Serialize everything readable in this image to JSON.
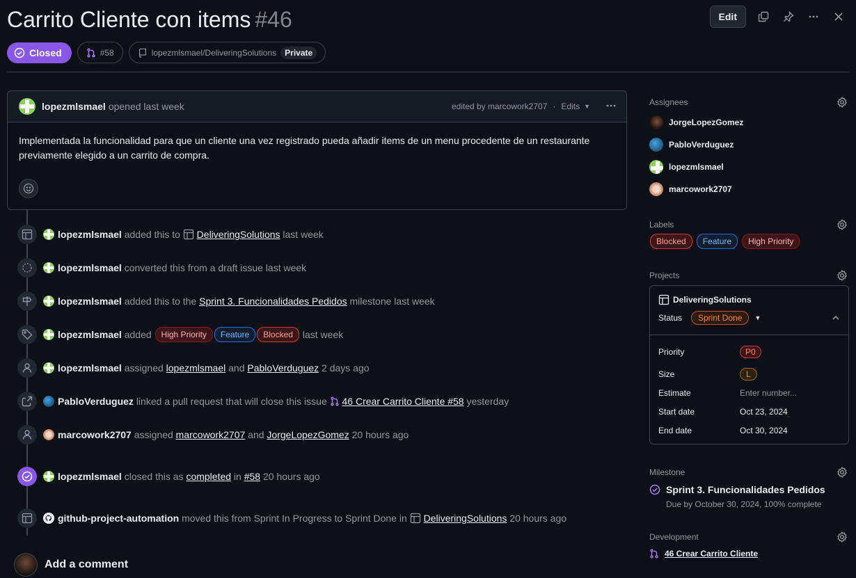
{
  "issue": {
    "title": "Carrito Cliente con items",
    "number": "#46",
    "state": "Closed",
    "pr_ref": "#58",
    "repo": "lopezmlsmael/DeliveringSolutions",
    "visibility": "Private"
  },
  "toolbar": {
    "edit_label": "Edit"
  },
  "comment": {
    "author": "lopezmlsmael",
    "opened": "opened last week",
    "edited": "edited by marcowork2707",
    "edits_label": "Edits",
    "body": "Implementada la funcionalidad para que un cliente una vez registrado pueda añadir items de un menu procedente de un restaurante previamente elegido a un carrito de compra."
  },
  "timeline": [
    {
      "actor": "lopezmlsmael",
      "t1": "added this to",
      "link": "DeliveringSolutions",
      "t2": "last week"
    },
    {
      "actor": "lopezmlsmael",
      "t1": "converted this from a draft issue last week"
    },
    {
      "actor": "lopezmlsmael",
      "t1": "added this to the",
      "link": "Sprint 3. Funcionalidades Pedidos",
      "t2": "milestone last week"
    },
    {
      "actor": "lopezmlsmael",
      "t1": "added",
      "labels": [
        "High Priority",
        "Feature",
        "Blocked"
      ],
      "t2": "last week"
    },
    {
      "actor": "lopezmlsmael",
      "t1": "assigned",
      "link": "lopezmlsmael",
      "mid": "and",
      "link2": "PabloVerduguez",
      "t2": "2 days ago"
    },
    {
      "actor": "PabloVerduguez",
      "t1": "linked a pull request that will close this issue",
      "link": "46 Crear Carrito Cliente #58",
      "t2": "yesterday"
    },
    {
      "actor": "marcowork2707",
      "t1": "assigned",
      "link": "marcowork2707",
      "mid": "and",
      "link2": "JorgeLopezGomez",
      "t2": "20 hours ago"
    },
    {
      "actor": "lopezmlsmael",
      "t1": "closed this as",
      "link": "completed",
      "mid": "in",
      "link2": "#58",
      "t2": "20 hours ago"
    },
    {
      "actor": "github-project-automation",
      "t1": "moved this from Sprint In Progress to Sprint Done in",
      "link": "DeliveringSolutions",
      "t2": "20 hours ago"
    }
  ],
  "add_comment": "Add a comment",
  "sidebar": {
    "assignees_title": "Assignees",
    "assignees": [
      "JorgeLopezGomez",
      "PabloVerduguez",
      "lopezmlsmael",
      "marcowork2707"
    ],
    "labels_title": "Labels",
    "labels": [
      "Blocked",
      "Feature",
      "High Priority"
    ],
    "projects_title": "Projects",
    "project": {
      "name": "DeliveringSolutions",
      "status_label": "Status",
      "status": "Sprint Done",
      "fields": [
        {
          "k": "Priority",
          "v": "P0"
        },
        {
          "k": "Size",
          "v": "L"
        },
        {
          "k": "Estimate",
          "v": "Enter number..."
        },
        {
          "k": "Start date",
          "v": "Oct 23, 2024"
        },
        {
          "k": "End date",
          "v": "Oct 30, 2024"
        }
      ]
    },
    "milestone_title": "Milestone",
    "milestone": {
      "name": "Sprint 3. Funcionalidades Pedidos",
      "due": "Due by October 30, 2024, 100% complete"
    },
    "development_title": "Development",
    "development_item": "46 Crear Carrito Cliente"
  },
  "colors": {
    "closed": "#8957e5",
    "bg": "#0d1117",
    "border": "#3d444d"
  }
}
